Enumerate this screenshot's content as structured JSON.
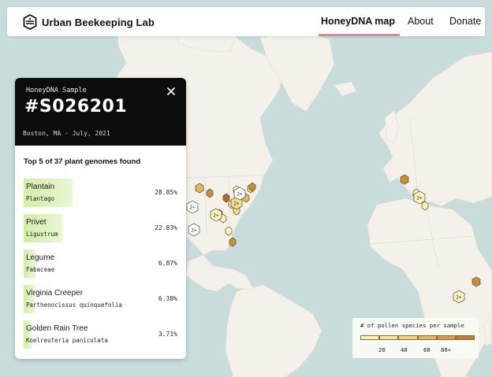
{
  "header": {
    "brand_name": "Urban Beekeeping Lab",
    "brand_icon": "hexagon-bee-icon",
    "nav": [
      {
        "label": "HoneyDNA map",
        "active": true
      },
      {
        "label": "About",
        "active": false
      },
      {
        "label": "Donate",
        "active": false
      }
    ],
    "accent_color": "#e98192"
  },
  "sample": {
    "kicker": "HoneyDNA Sample",
    "id": "#S026201",
    "location_date": "Boston, MA · July, 2021",
    "close_icon": "close-icon",
    "plants_heading": "Top 5 of 37 plant genomes found",
    "plants": [
      {
        "name": "Plantain",
        "latin": "Plantago",
        "percent": "28.85%",
        "share": 28.85
      },
      {
        "name": "Privet",
        "latin": "Ligustrum",
        "percent": "22.83%",
        "share": 22.83
      },
      {
        "name": "Legume",
        "latin": "Fabaceae",
        "percent": "6.87%",
        "share": 6.87
      },
      {
        "name": "Virginia Creeper",
        "latin": "Parthenocissus quinquefolia",
        "percent": "6.38%",
        "share": 6.38
      },
      {
        "name": "Golden Rain Tree",
        "latin": "Koelreuteria paniculata",
        "percent": "3.71%",
        "share": 3.71
      }
    ],
    "bar_color": "#d2eea7"
  },
  "map": {
    "ocean_color": "#c9dcdc",
    "land_color": "#f3f1ea",
    "cluster_label": "2+",
    "marker_colors": [
      "#fbf2c0",
      "#f3dc8a",
      "#e6b45c",
      "#c98d3a",
      "#b06a28"
    ]
  },
  "legend": {
    "title": "# of pollen species per sample",
    "ticks": [
      "20",
      "40",
      "60",
      "80+"
    ],
    "colors": [
      "#fbf2c0",
      "#f6e6a4",
      "#efd184",
      "#e6b45c",
      "#d49a48",
      "#c07e34"
    ]
  }
}
